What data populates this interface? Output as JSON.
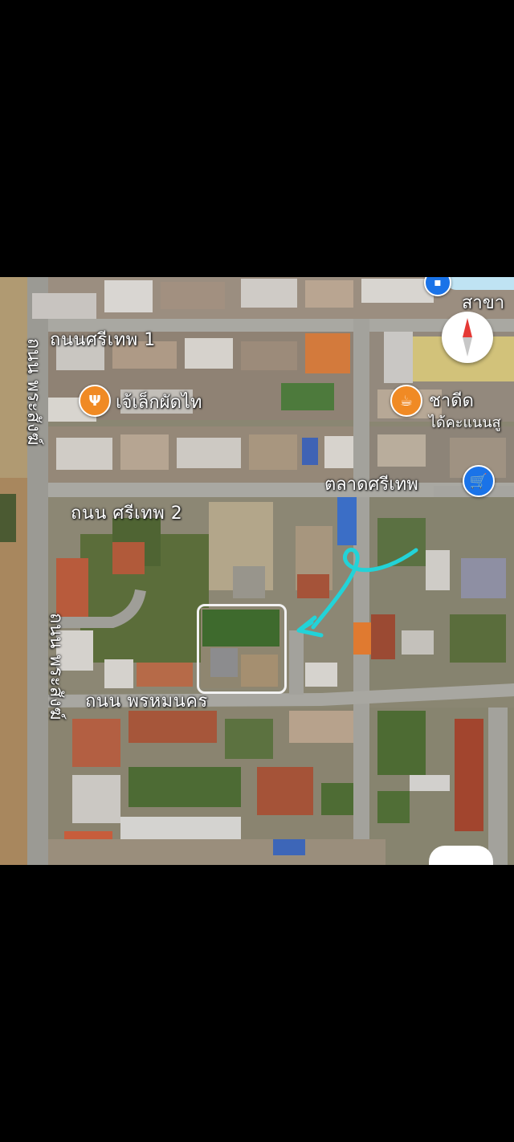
{
  "map": {
    "roads": {
      "sri_thep_1": "ถนนศรีเทพ 1",
      "sri_thep_2": "ถนน ศรีเทพ 2",
      "phrom_nakhon": "ถนน พรหมนคร",
      "phra_sang_top": "ถนน พระสังฆ์",
      "phra_sang_bottom": "ถนน พระสังฆ์"
    },
    "places": {
      "restaurant": "เจ้เล็กผัดไท",
      "cafe": "ชาดีด",
      "cafe_rating": "ได้คะแนนสู",
      "market": "ตลาดศรีเทพ",
      "top_right": "สาขา"
    },
    "icons": {
      "restaurant": "fork-knife-icon",
      "cafe": "coffee-cup-icon",
      "market": "shopping-cart-icon",
      "compass": "compass-icon",
      "top_pin": "bookmark-pin-icon"
    },
    "colors": {
      "restaurant_pin": "#f08a24",
      "cafe_pin": "#f08a24",
      "market_pin": "#1a73e8",
      "annotation_arrow": "#22d3d8",
      "selection_box": "#f2f2f2"
    }
  }
}
